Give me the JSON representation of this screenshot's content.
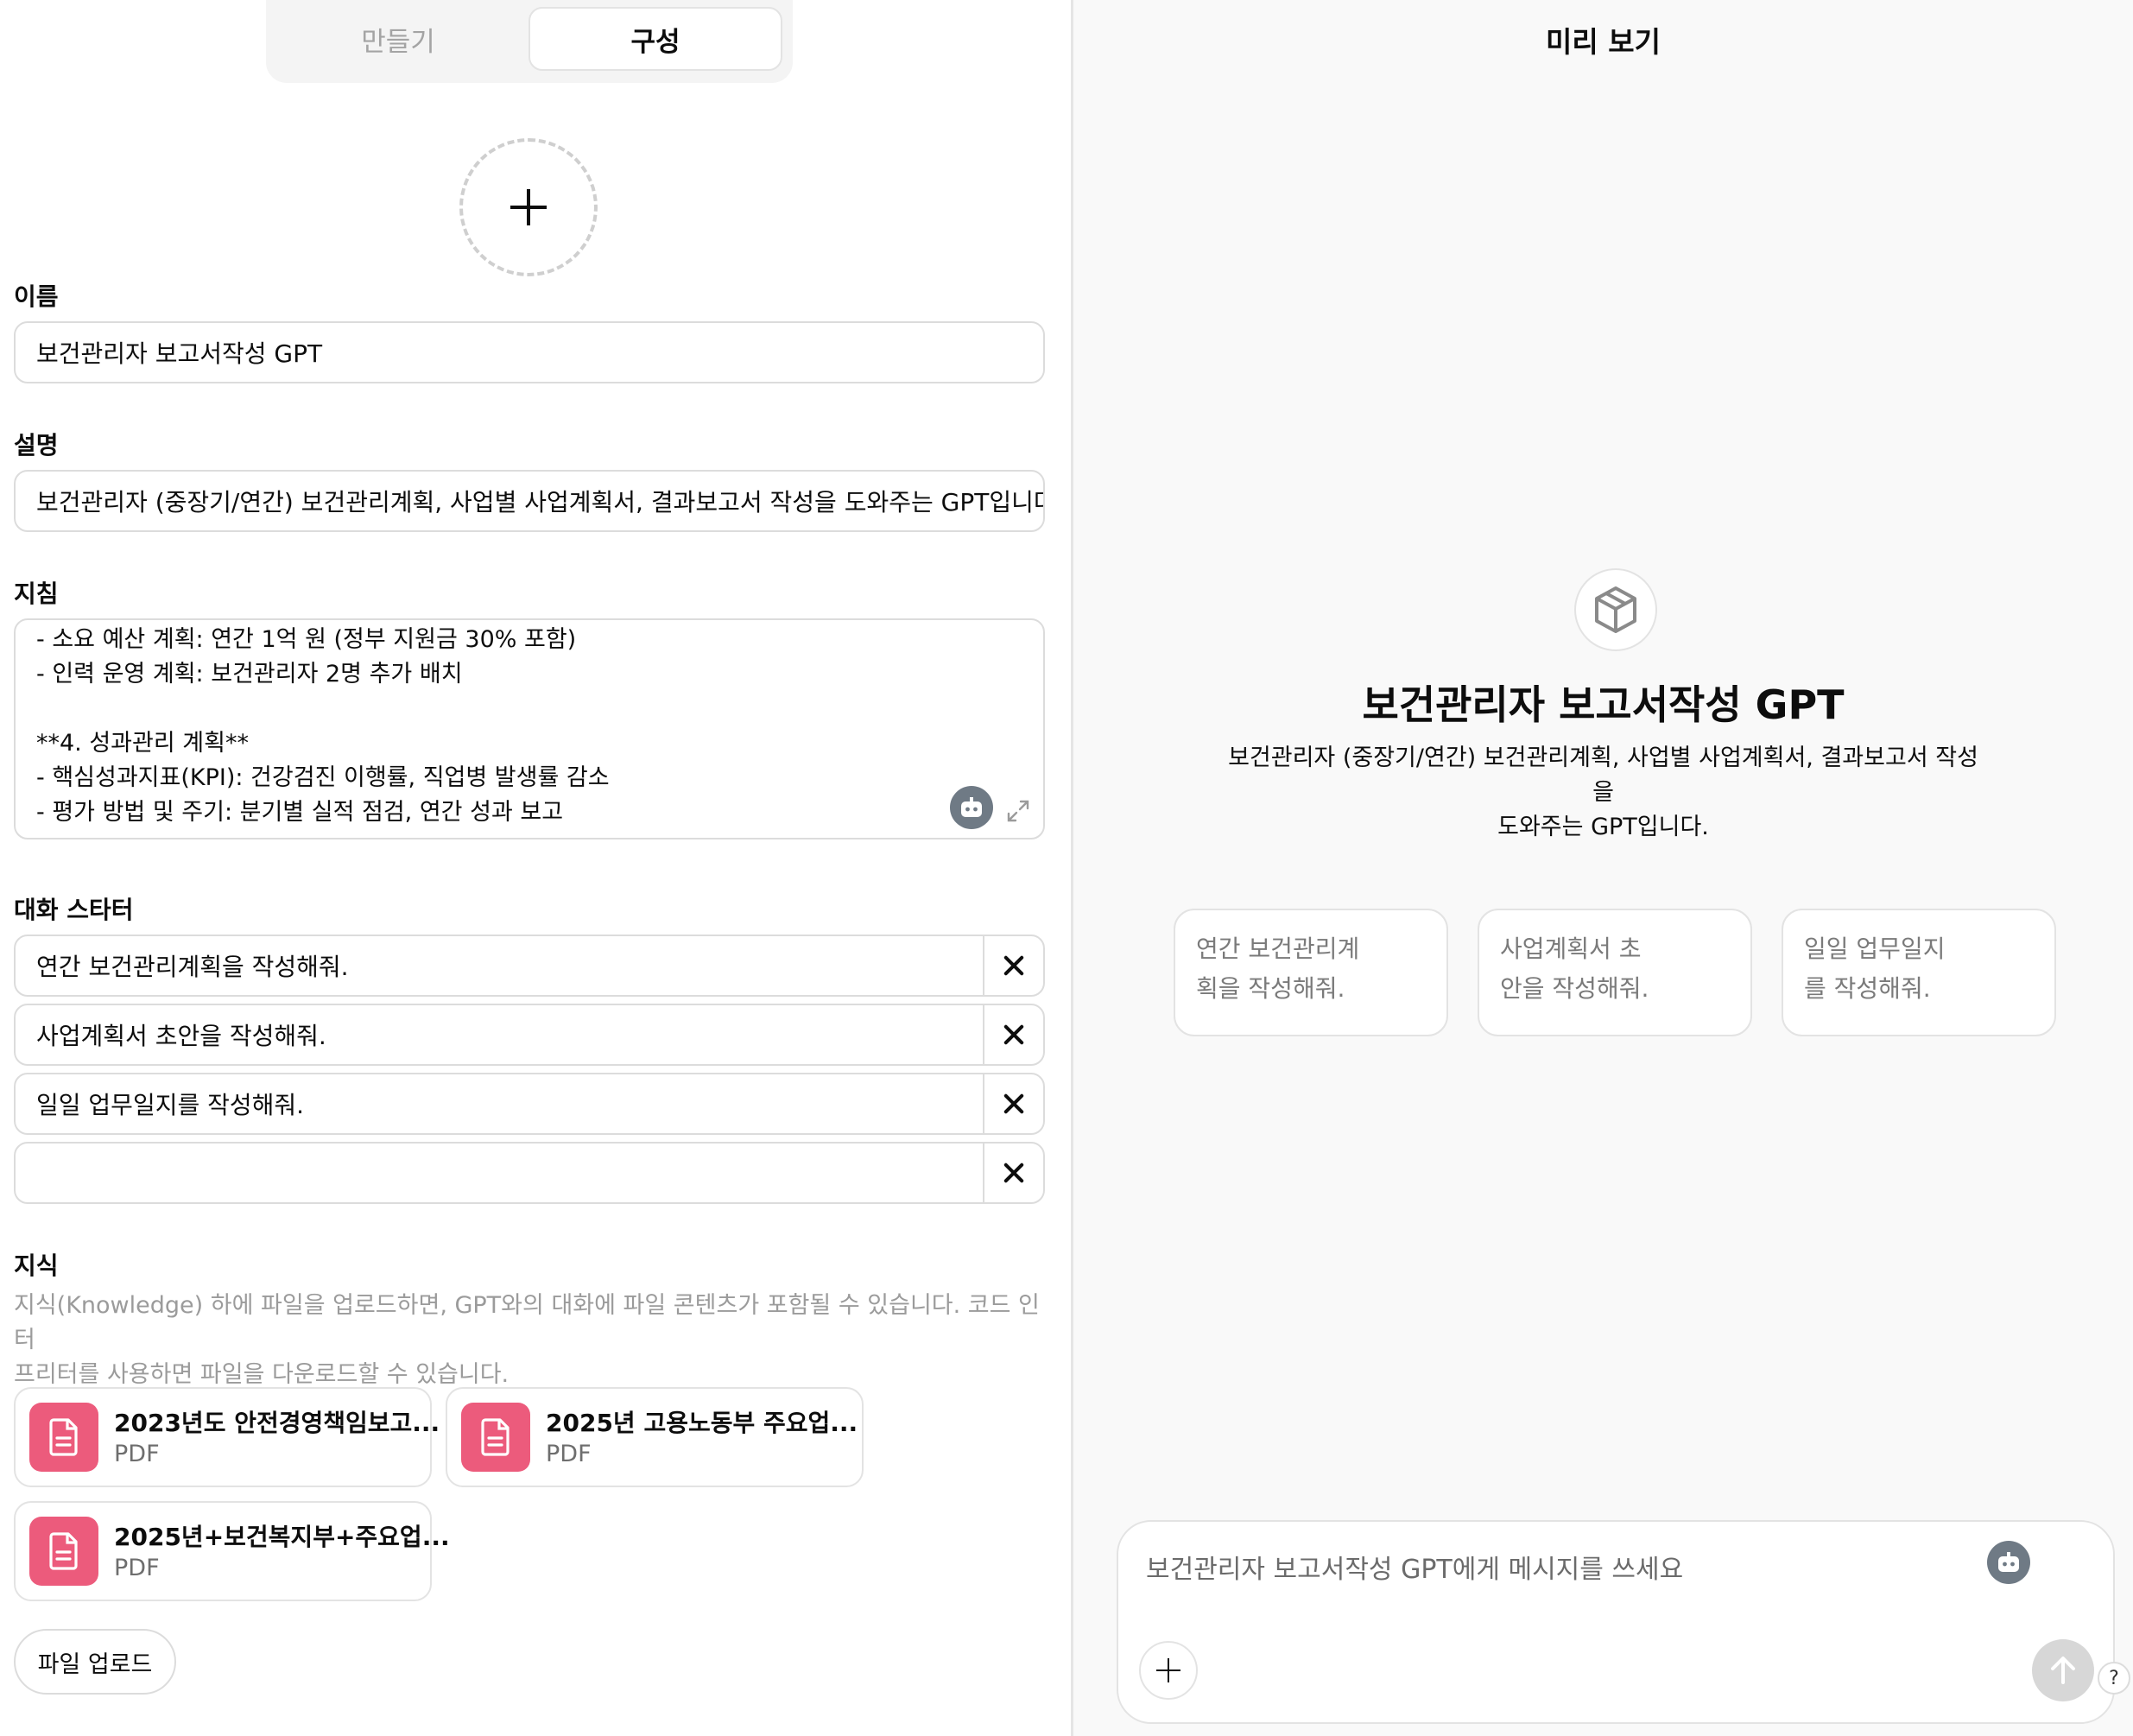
{
  "tabs": {
    "create": "만들기",
    "configure": "구성"
  },
  "name": {
    "label": "이름",
    "value": "보건관리자 보고서작성 GPT"
  },
  "description": {
    "label": "설명",
    "value": "보건관리자 (중장기/연간) 보건관리계획, 사업별 사업계획서, 결과보고서 작성을 도와주는 GPT입니다."
  },
  "instructions": {
    "label": "지침",
    "lines": [
      "- 소요 예산 계획: 연간 1억 원 (정부 지원금 30% 포함)",
      "- 인력 운영 계획: 보건관리자 2명 추가 배치",
      "",
      "**4. 성과관리 계획**",
      "- 핵심성과지표(KPI): 건강검진 이행률, 직업병 발생률 감소",
      "- 평가 방법 및 주기: 분기별 실적 점검, 연간 성과 보고"
    ]
  },
  "starters": {
    "label": "대화 스타터",
    "items": [
      "연간 보건관리계획을 작성해줘.",
      "사업계획서 초안을 작성해줘.",
      "일일 업무일지를 작성해줘.",
      ""
    ]
  },
  "knowledge": {
    "label": "지식",
    "hint_line1": "지식(Knowledge) 하에 파일을 업로드하면, GPT와의 대화에 파일 콘텐츠가 포함될 수 있습니다. 코드 인터",
    "hint_line2": "프리터를 사용하면 파일을 다운로드할 수 있습니다.",
    "files": [
      {
        "name": "2023년도 안전경영책임보고...",
        "type": "PDF"
      },
      {
        "name": "2025년 고용노동부 주요업...",
        "type": "PDF"
      },
      {
        "name": "2025년+보건복지부+주요업...",
        "type": "PDF"
      }
    ],
    "upload_label": "파일 업로드"
  },
  "preview": {
    "title": "미리 보기",
    "gpt_name": "보건관리자 보고서작성 GPT",
    "gpt_desc_line1": "보건관리자 (중장기/연간) 보건관리계획, 사업별 사업계획서, 결과보고서 작성을",
    "gpt_desc_line2": "도와주는 GPT입니다.",
    "suggestions": [
      {
        "line1": "연간 보건관리계",
        "line2": "획을 작성해줘."
      },
      {
        "line1": "사업계획서 초",
        "line2": "안을 작성해줘."
      },
      {
        "line1": "일일 업무일지",
        "line2": "를 작성해줘."
      }
    ],
    "composer_placeholder": "보건관리자 보고서작성 GPT에게 메시지를 쓰세요",
    "help": "?"
  },
  "colors": {
    "file_icon": "#ec5b7c",
    "bot_icon": "#6f7a85",
    "send_disabled": "#d7d7d7"
  }
}
